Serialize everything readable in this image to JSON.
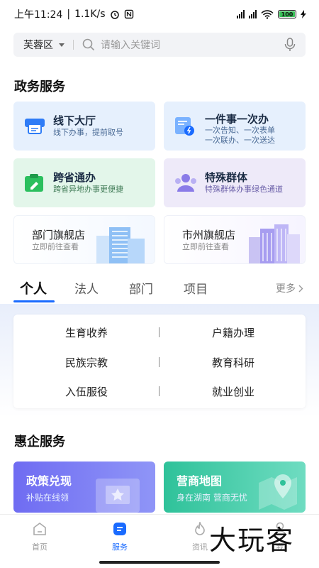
{
  "status": {
    "time": "上午11:24",
    "speed": "1.1K/s",
    "battery": "100"
  },
  "search": {
    "district": "芙蓉区",
    "placeholder": "请输入关键词"
  },
  "gov_services": {
    "title": "政务服务",
    "cards": [
      {
        "title": "线下大厅",
        "sub": "线下办事，提前取号"
      },
      {
        "title": "一件事一次办",
        "sub1": "一次告知、一次表单",
        "sub2": "一次联办、一次送达"
      },
      {
        "title": "跨省通办",
        "sub": "跨省异地办事更便捷"
      },
      {
        "title": "特殊群体",
        "sub": "特殊群体办事绿色通道"
      },
      {
        "title": "部门旗舰店",
        "sub": "立即前往查看"
      },
      {
        "title": "市州旗舰店",
        "sub": "立即前往查看"
      }
    ]
  },
  "tabs": {
    "items": [
      "个人",
      "法人",
      "部门",
      "项目"
    ],
    "active": "个人",
    "more": "更多"
  },
  "categories": [
    "生育收养",
    "户籍办理",
    "民族宗教",
    "教育科研",
    "入伍服役",
    "就业创业"
  ],
  "enterprise": {
    "title": "惠企服务",
    "cards": [
      {
        "title": "政策兑现",
        "sub": "补贴在线领"
      },
      {
        "title": "营商地图",
        "sub": "身在湖南 营商无忧"
      }
    ]
  },
  "nav": {
    "items": [
      "首页",
      "服务",
      "资讯",
      "我"
    ],
    "active": "服务"
  },
  "watermark": "大玩客",
  "colors": {
    "accent": "#1a6bff",
    "card_blue": "#e6f0fd",
    "card_green": "#e3f6ea",
    "card_purple": "#eeeaf9"
  }
}
